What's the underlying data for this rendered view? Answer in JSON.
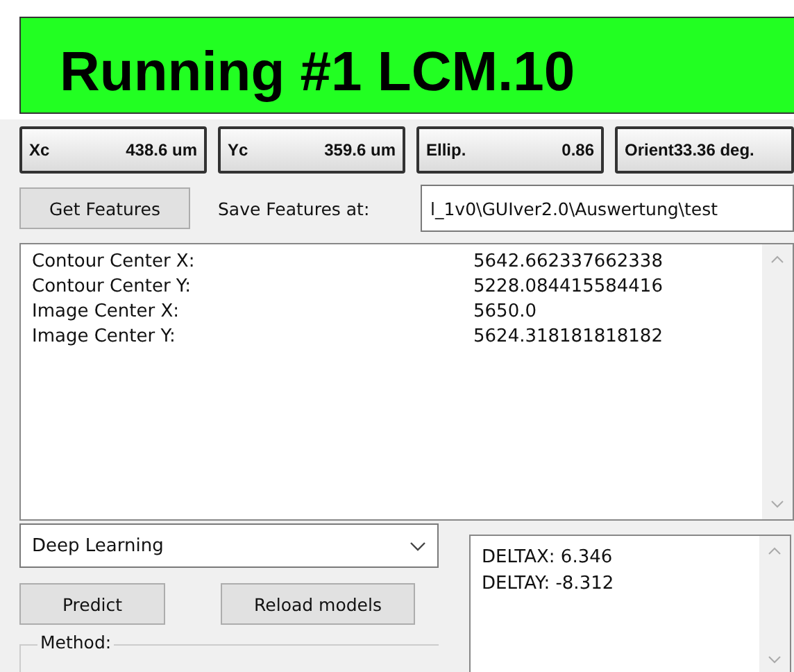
{
  "status_banner": {
    "text": "Running #1 LCM.10"
  },
  "measurements": [
    {
      "label": "Xc",
      "value": "438.6 um"
    },
    {
      "label": "Yc",
      "value": "359.6 um"
    },
    {
      "label": "Ellip.",
      "value": "0.86"
    },
    {
      "label": "Orient",
      "value": "33.36 deg."
    }
  ],
  "get_features_button": "Get Features",
  "save_label": "Save Features at:",
  "save_path": {
    "value": "l_1v0\\GUIver2.0\\Auswertung\\test"
  },
  "features": [
    {
      "name": "Contour Center X:",
      "value": "5642.662337662338"
    },
    {
      "name": "Contour Center Y:",
      "value": "5228.084415584416"
    },
    {
      "name": "Image Center X:",
      "value": "5650.0"
    },
    {
      "name": "Image Center Y:",
      "value": "5624.318181818182"
    }
  ],
  "model_dropdown": {
    "value": "Deep Learning"
  },
  "buttons": [
    "Predict",
    "Reload models"
  ],
  "method_group": {
    "title": "Method:"
  },
  "prediction_output": [
    "DELTAX: 6.346",
    "DELTAY: -8.312"
  ]
}
